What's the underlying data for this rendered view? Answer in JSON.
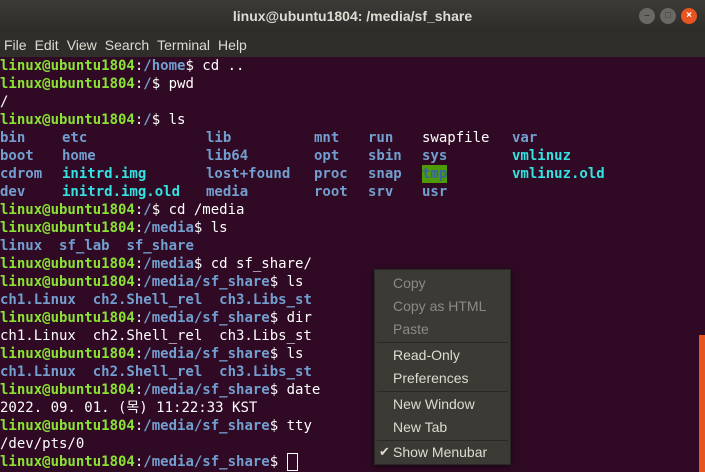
{
  "window": {
    "title": "linux@ubuntu1804: /media/sf_share"
  },
  "menubar": [
    "File",
    "Edit",
    "View",
    "Search",
    "Terminal",
    "Help"
  ],
  "prompt_user": "linux@ubuntu1804",
  "terminal": {
    "l0_path": "/home",
    "l0_cmd": "$ cd ..",
    "l1_path": "/",
    "l1_cmd": "$ pwd",
    "l2_out": "/",
    "l3_path": "/",
    "l3_cmd": "$ ls",
    "ls_root": [
      [
        "bin",
        "etc",
        "lib",
        "mnt",
        "run",
        "swapfile",
        "var"
      ],
      [
        "boot",
        "home",
        "lib64",
        "opt",
        "sbin",
        "sys",
        "vmlinuz"
      ],
      [
        "cdrom",
        "initrd.img",
        "lost+found",
        "proc",
        "snap",
        "tmp",
        "vmlinuz.old"
      ],
      [
        "dev",
        "initrd.img.old",
        "media",
        "root",
        "srv",
        "usr",
        ""
      ]
    ],
    "l8_path": "/",
    "l8_cmd": "$ cd /media",
    "l9_path": "/media",
    "l9_cmd": "$ ls",
    "l10_items": [
      "linux",
      "sf_lab",
      "sf_share"
    ],
    "l11_path": "/media",
    "l11_cmd": "$ cd sf_share/",
    "l12_path": "/media/sf_share",
    "l12_cmd": "$ ls",
    "l13_items": [
      "ch1.Linux",
      "ch2.Shell_rel",
      "ch3.Libs_st"
    ],
    "l14_path": "/media/sf_share",
    "l14_cmd": "$ dir",
    "l15_out": "ch1.Linux  ch2.Shell_rel  ch3.Libs_st",
    "l16_path": "/media/sf_share",
    "l16_cmd": "$ ls",
    "l17_items": [
      "ch1.Linux",
      "ch2.Shell_rel",
      "ch3.Libs_st"
    ],
    "l18_path": "/media/sf_share",
    "l18_cmd": "$ date",
    "l19_out": "2022. 09. 01. (목) 11:22:33 KST",
    "l20_path": "/media/sf_share",
    "l20_cmd": "$ tty",
    "l21_out": "/dev/pts/0",
    "l22_path": "/media/sf_share",
    "l22_cmd": "$ "
  },
  "context_menu": {
    "copy": "Copy",
    "copy_html": "Copy as HTML",
    "paste": "Paste",
    "read_only": "Read-Only",
    "preferences": "Preferences",
    "new_window": "New Window",
    "new_tab": "New Tab",
    "show_menubar": "Show Menubar",
    "check": "✔"
  },
  "colors": {
    "background": "#300a24",
    "prompt": "#8ae234",
    "directory": "#729fcf",
    "executable": "#34e2e2",
    "accent": "#e95420"
  }
}
